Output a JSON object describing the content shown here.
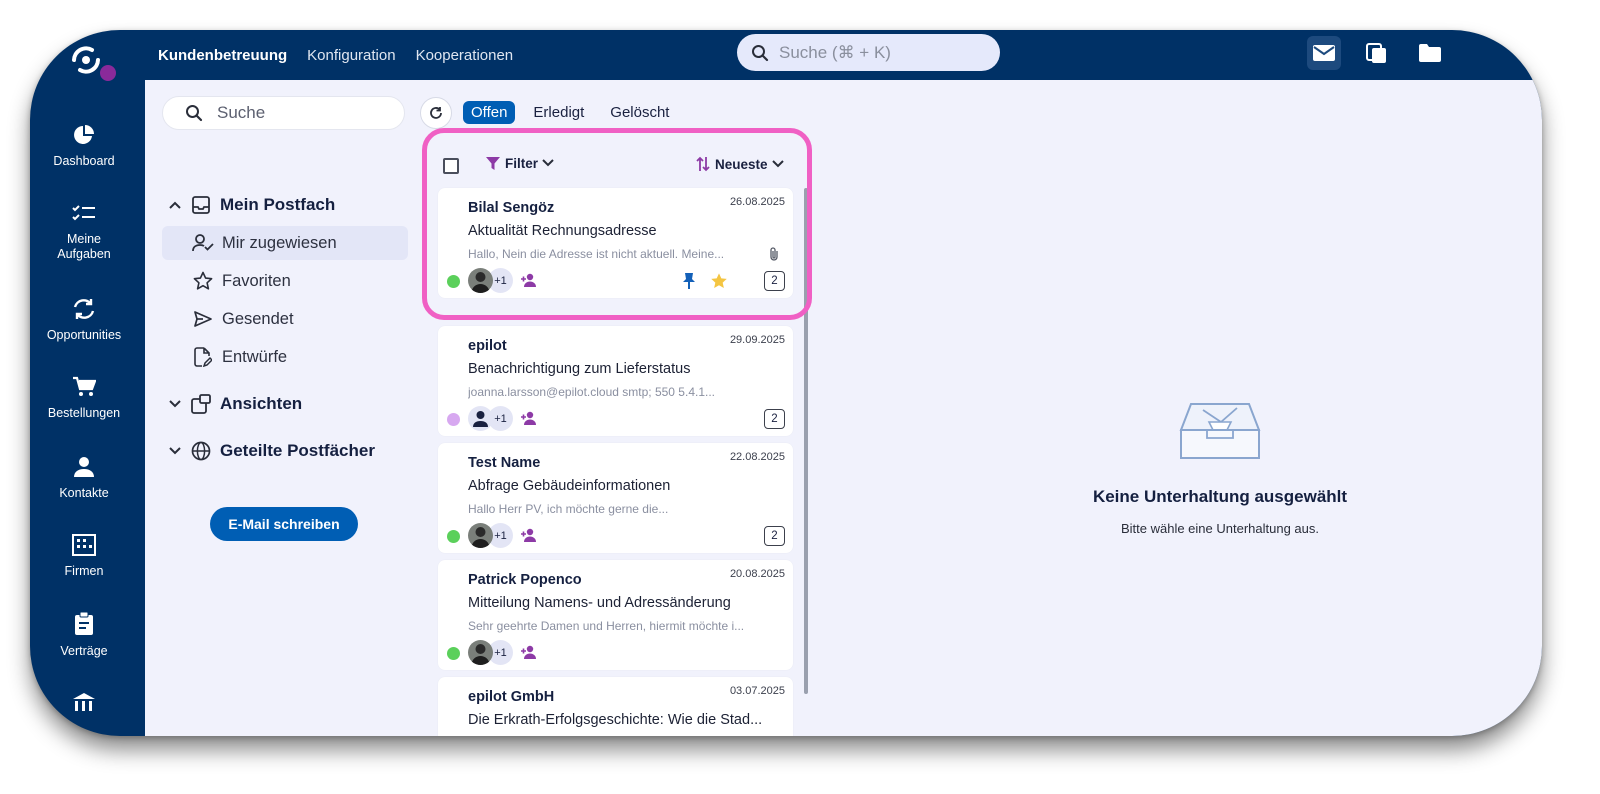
{
  "topbar": {
    "nav": [
      "Kundenbetreuung",
      "Konfiguration",
      "Kooperationen"
    ],
    "search_placeholder": "Suche (⌘ + K)"
  },
  "rail": {
    "items": [
      "Dashboard",
      "Meine Aufgaben",
      "Opportunities",
      "Bestellungen",
      "Kontakte",
      "Firmen",
      "Verträge"
    ]
  },
  "sidebar": {
    "search_placeholder": "Suche",
    "mailbox_title": "Mein Postfach",
    "items": [
      "Mir zugewiesen",
      "Favoriten",
      "Gesendet",
      "Entwürfe"
    ],
    "views_title": "Ansichten",
    "shared_title": "Geteilte Postfächer",
    "compose_label": "E-Mail schreiben"
  },
  "tabs": [
    "Offen",
    "Erledigt",
    "Gelöscht"
  ],
  "list": {
    "filter_label": "Filter",
    "sort_label": "Neueste",
    "conversations": [
      {
        "sender": "Bilal Sengöz",
        "date": "26.08.2025",
        "subject": "Aktualität Rechnungsadresse",
        "preview": "Hallo, Nein die Adresse ist nicht aktuell. Meine...",
        "more": "+1",
        "count": "2"
      },
      {
        "sender": "epilot",
        "date": "29.09.2025",
        "subject": "Benachrichtigung zum Lieferstatus",
        "preview": "joanna.larsson@epilot.cloud smtp; 550 5.4.1...",
        "more": "+1",
        "count": "2"
      },
      {
        "sender": "Test Name",
        "date": "22.08.2025",
        "subject": "Abfrage Gebäudeinformationen",
        "preview": "Hallo Herr PV, ich möchte gerne die...",
        "more": "+1",
        "count": "2"
      },
      {
        "sender": "Patrick Popenco",
        "date": "20.08.2025",
        "subject": "Mitteilung Namens- und Adressänderung",
        "preview": "Sehr geehrte Damen und Herren, hiermit möchte i...",
        "more": "+1",
        "count": ""
      },
      {
        "sender": "epilot GmbH",
        "date": "03.07.2025",
        "subject": "Die Erkrath-Erfolgsgeschichte: Wie die Stad...",
        "preview": "",
        "more": "",
        "count": ""
      }
    ]
  },
  "empty_state": {
    "title": "Keine Unterhaltung ausgewählt",
    "subtitle": "Bitte wähle eine Unterhaltung aus."
  },
  "colors": {
    "navy": "#003166",
    "accent": "#005eb4",
    "highlight": "#f060c4",
    "status_green": "#5bd05b",
    "status_purple": "#d7a8f0",
    "assign_purple": "#8d3aa6"
  }
}
